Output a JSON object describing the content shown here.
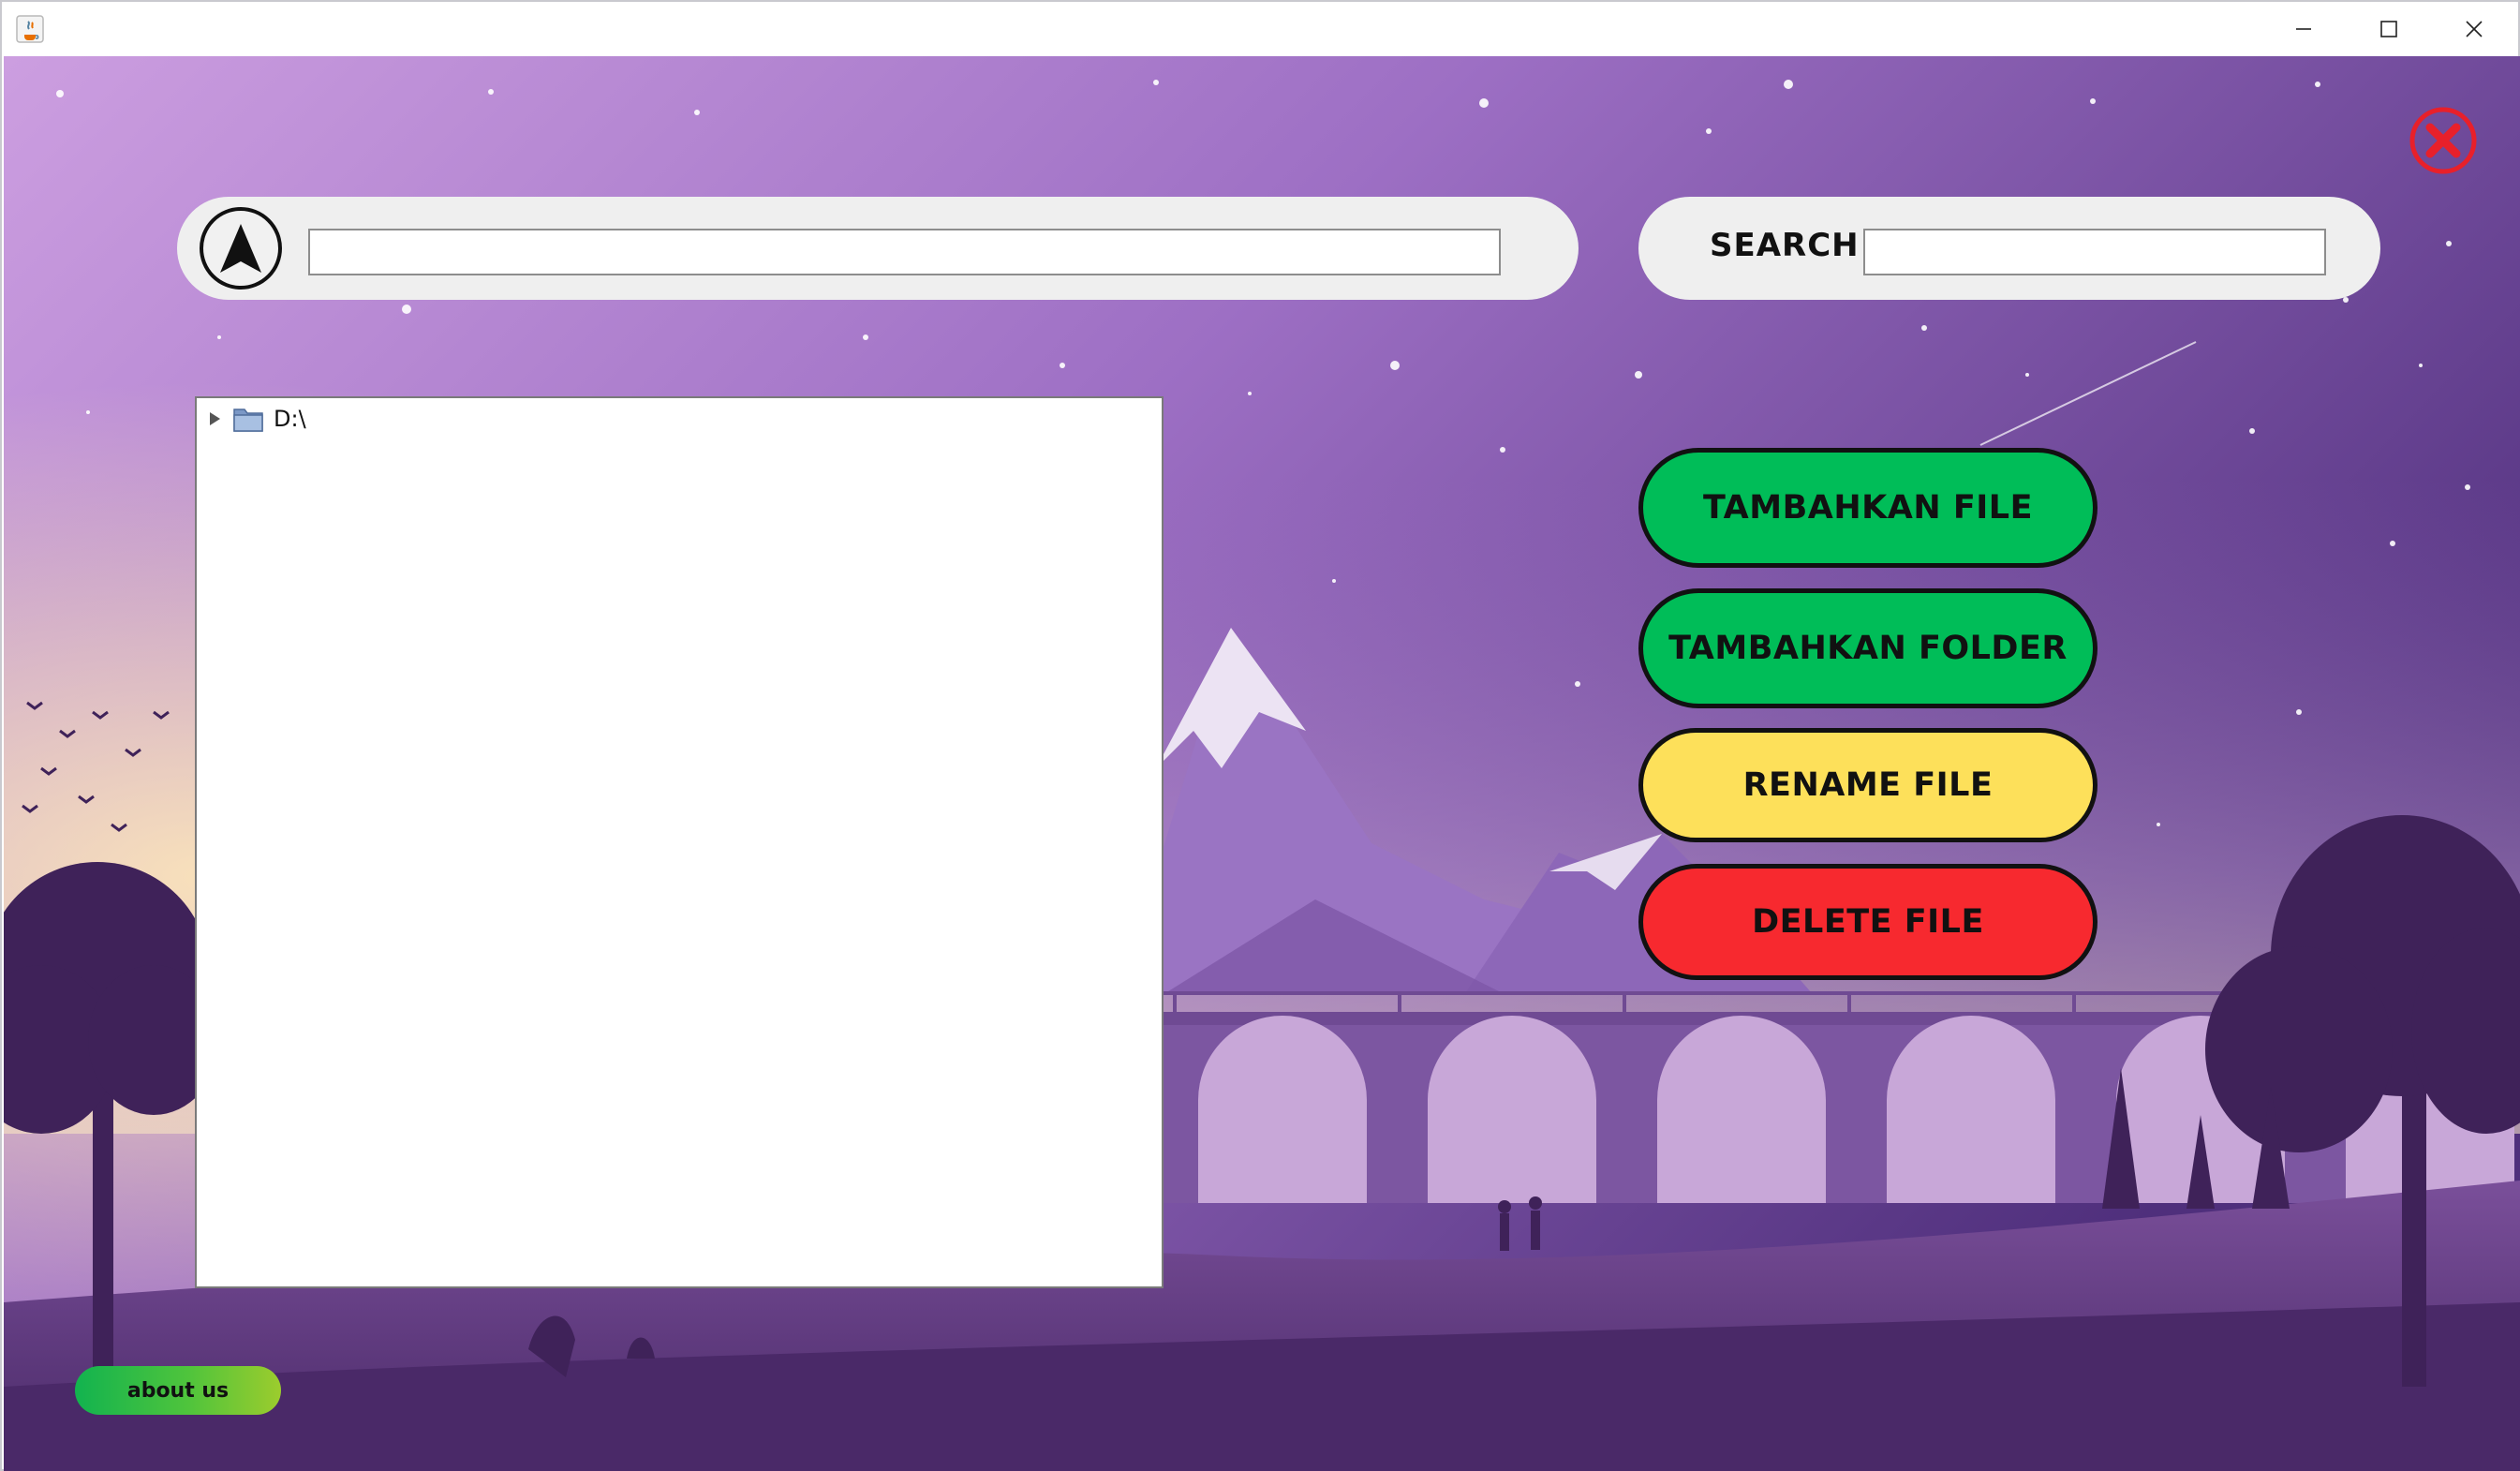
{
  "window": {
    "controls": [
      "minimize-icon",
      "maximize-icon",
      "close-icon"
    ]
  },
  "path_bar": {
    "up_icon": "navigate-up-icon",
    "path_value": ""
  },
  "search": {
    "label": "SEARCH",
    "value": ""
  },
  "exit_icon": "exit-icon",
  "tree": {
    "items": [
      {
        "label": "D:\\",
        "expanded": false,
        "icon": "folder-icon"
      }
    ]
  },
  "actions": {
    "add_file": "TAMBAHKAN FILE",
    "add_folder": "TAMBAHKAN FOLDER",
    "rename_file": "RENAME FILE",
    "delete_file": "DELETE FILE"
  },
  "about": {
    "label": "about us"
  },
  "colors": {
    "add": "#00bd58",
    "rename": "#fde05a",
    "delete": "#f7292f",
    "exit": "#e8202a",
    "background_top": "#c597dc",
    "background_bottom": "#4b2a6e"
  }
}
